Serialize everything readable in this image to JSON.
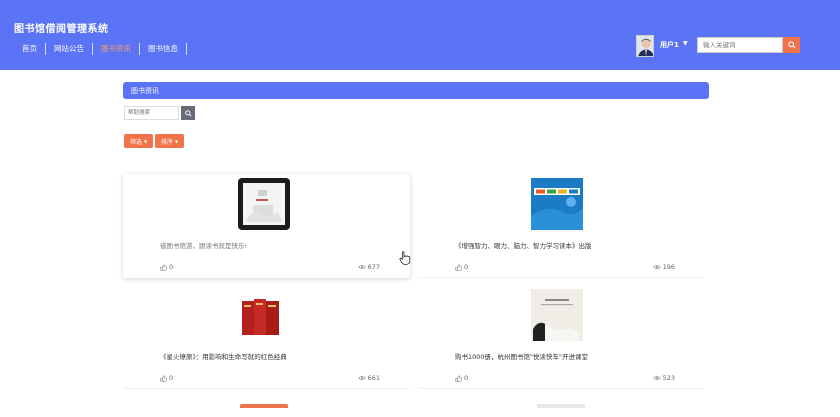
{
  "header": {
    "site_title": "图书馆借阅管理系统",
    "nav": [
      {
        "label": "首页",
        "active": false
      },
      {
        "label": "网站公告",
        "active": false
      },
      {
        "label": "图书资讯",
        "active": true
      },
      {
        "label": "图书信息",
        "active": false
      }
    ],
    "username": "用户1",
    "search_placeholder": "输入关键词"
  },
  "section": {
    "title": "图书资讯",
    "search_placeholder": "帮助搜索",
    "filter_label": "筛选",
    "sort_label": "排序"
  },
  "cards": [
    {
      "title": "借图书馆游，跟读书就是快乐!",
      "likes": "0",
      "views": "677"
    },
    {
      "title": "《增强智力、眼力、脑力、智力学习读本》出版",
      "likes": "0",
      "views": "196"
    },
    {
      "title": "《星火燎原》：用影响和生命写就的红色经典",
      "likes": "0",
      "views": "661"
    },
    {
      "title": "购书1000册，杭州图书馆\"悦读快车\"开进课堂",
      "likes": "0",
      "views": "523"
    }
  ],
  "colors": {
    "header_bg": "#5b74f5",
    "accent_orange": "#f0734a",
    "nav_active": "#ff9a6a"
  }
}
